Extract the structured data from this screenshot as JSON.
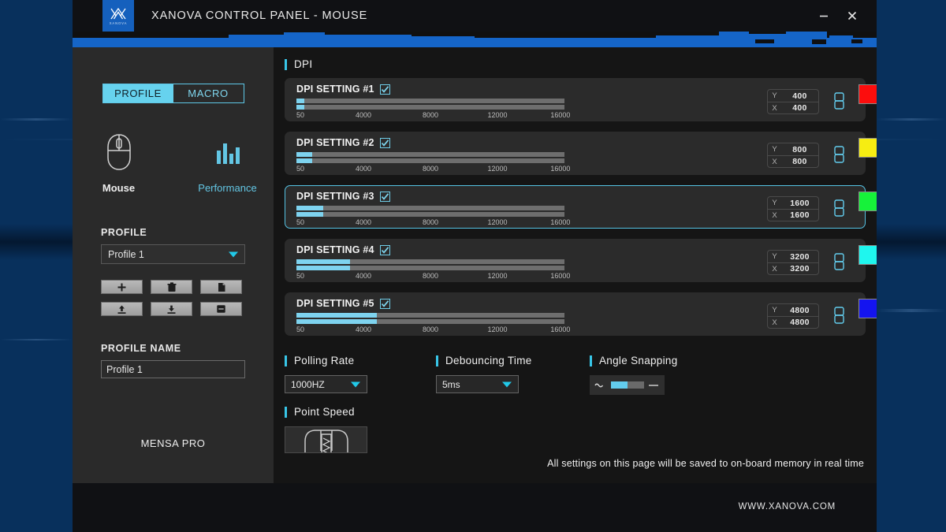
{
  "window": {
    "title": "XANOVA CONTROL PANEL - MOUSE",
    "logo_word": "XANOVA",
    "minimize_label": "–",
    "close_label": "×"
  },
  "sidebar": {
    "tabs": [
      {
        "label": "PROFILE",
        "active": true
      },
      {
        "label": "MACRO",
        "active": false
      }
    ],
    "devices": [
      {
        "label": "Mouse",
        "icon": "mouse-icon",
        "active": true
      },
      {
        "label": "Performance",
        "icon": "performance-bars-icon",
        "active": false
      }
    ],
    "profile_heading": "PROFILE",
    "profile_selected": "Profile 1",
    "buttons": [
      {
        "name": "add-profile-button",
        "icon": "plus-icon"
      },
      {
        "name": "delete-profile-button",
        "icon": "trash-icon"
      },
      {
        "name": "copy-profile-button",
        "icon": "copy-icon"
      },
      {
        "name": "export-profile-button",
        "icon": "upload-icon"
      },
      {
        "name": "import-profile-button",
        "icon": "download-icon"
      },
      {
        "name": "save-profile-button",
        "icon": "save-icon"
      }
    ],
    "profile_name_heading": "PROFILE NAME",
    "profile_name_value": "Profile 1",
    "device_name": "MENSA PRO"
  },
  "main": {
    "dpi_heading": "DPI",
    "slider_ticks": [
      "50",
      "4000",
      "8000",
      "12000",
      "16000"
    ],
    "axis_y_label": "Y",
    "axis_x_label": "X",
    "dpi_settings": [
      {
        "label": "DPI SETTING #1",
        "enabled": true,
        "y": "400",
        "x": "400",
        "fill_pct": 3,
        "color": "#fc0d0d",
        "selected": false
      },
      {
        "label": "DPI SETTING #2",
        "enabled": true,
        "y": "800",
        "x": "800",
        "fill_pct": 6,
        "color": "#f6ed12",
        "selected": false
      },
      {
        "label": "DPI SETTING #3",
        "enabled": true,
        "y": "1600",
        "x": "1600",
        "fill_pct": 10,
        "color": "#16f23a",
        "selected": true
      },
      {
        "label": "DPI SETTING #4",
        "enabled": true,
        "y": "3200",
        "x": "3200",
        "fill_pct": 20,
        "color": "#1ff6ee",
        "selected": false
      },
      {
        "label": "DPI SETTING #5",
        "enabled": true,
        "y": "4800",
        "x": "4800",
        "fill_pct": 30,
        "color": "#1414f0",
        "selected": false
      }
    ],
    "polling_rate": {
      "heading": "Polling Rate",
      "value": "1000HZ"
    },
    "debouncing_time": {
      "heading": "Debouncing Time",
      "value": "5ms"
    },
    "angle_snapping": {
      "heading": "Angle Snapping",
      "off_icon": "wave-line-icon",
      "on_icon": "straight-line-icon"
    },
    "point_speed": {
      "heading": "Point Speed",
      "icon": "mouse-top-view-icon"
    },
    "save_note": "All settings on this page will be saved to on-board memory in real time"
  },
  "footer": {
    "url": "WWW.XANOVA.COM"
  },
  "colors": {
    "accent_cyan": "#38c6e8",
    "brand_blue": "#1565c8",
    "panel_dark": "#2b2b2b"
  }
}
